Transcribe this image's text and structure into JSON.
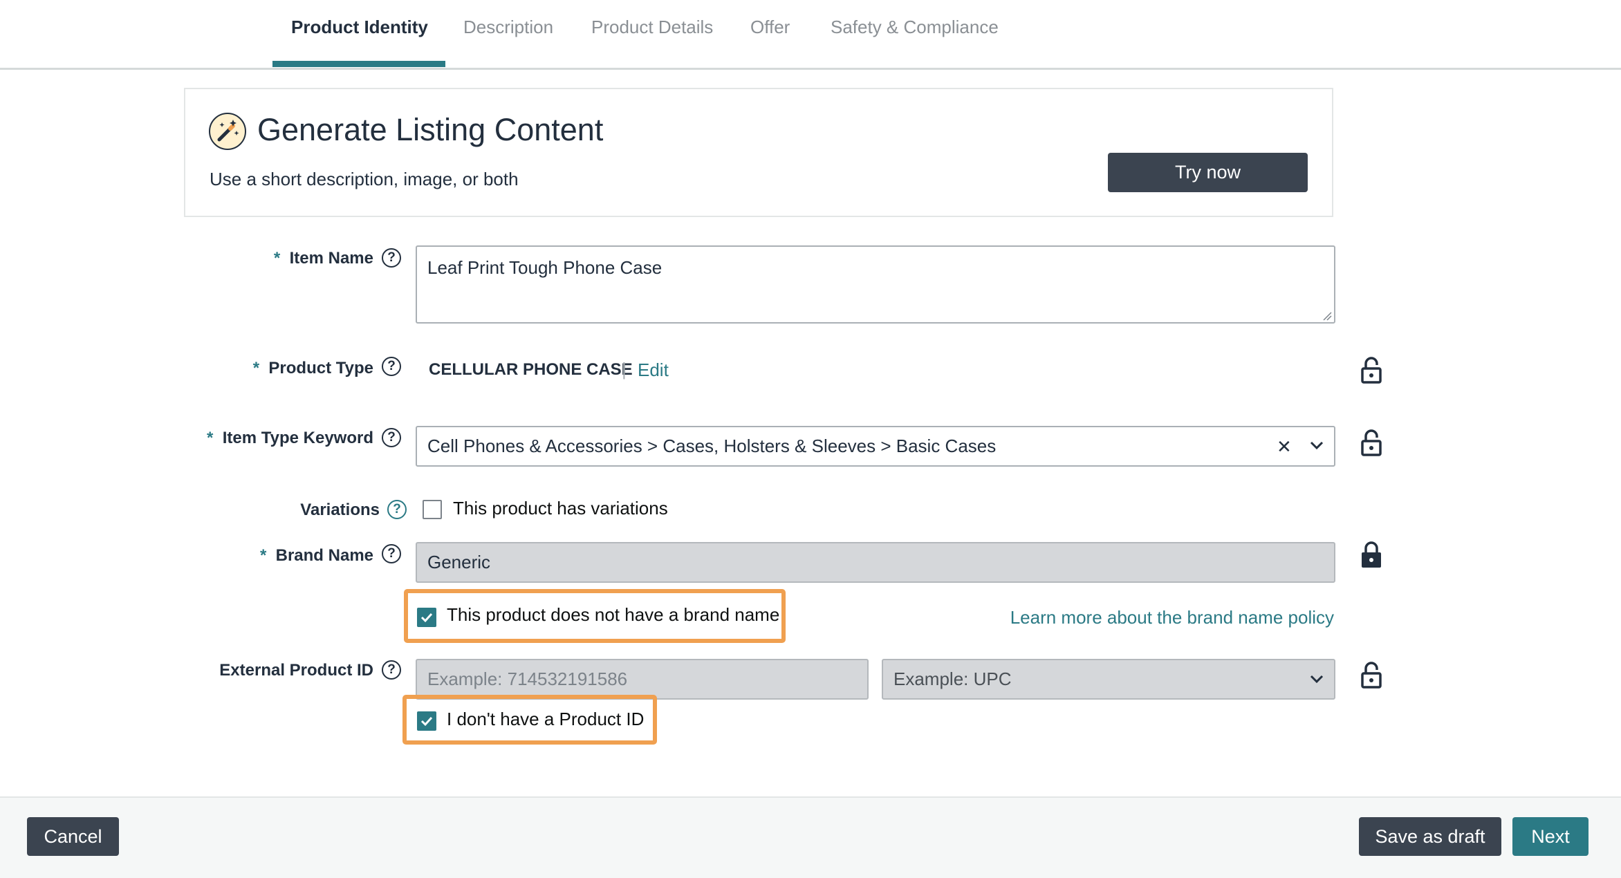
{
  "tabs": [
    {
      "label": "Product Identity",
      "active": true
    },
    {
      "label": "Description",
      "active": false
    },
    {
      "label": "Product Details",
      "active": false
    },
    {
      "label": "Offer",
      "active": false
    },
    {
      "label": "Safety & Compliance",
      "active": false
    }
  ],
  "generate": {
    "title": "Generate Listing Content",
    "subtitle": "Use a short description, image, or both",
    "button": "Try now",
    "icon": "magic-wand-icon"
  },
  "form": {
    "required_mark": "*",
    "help_glyph": "?",
    "item_name": {
      "label": "Item Name",
      "value": "Leaf Print Tough Phone Case"
    },
    "product_type": {
      "label": "Product Type",
      "value": "CELLULAR PHONE CASE",
      "separator": "|",
      "edit_label": "Edit"
    },
    "item_type_keyword": {
      "label": "Item Type Keyword",
      "value": "Cell Phones & Accessories > Cases, Holsters & Sleeves > Basic Cases",
      "clear_glyph": "✕"
    },
    "variations": {
      "label": "Variations",
      "checkbox_label": "This product has variations",
      "checked": false
    },
    "brand_name": {
      "label": "Brand Name",
      "value": "Generic",
      "no_brand_label": "This product does not have a brand name",
      "no_brand_checked": true,
      "policy_link": "Learn more about the brand name policy"
    },
    "external_product_id": {
      "label": "External Product ID",
      "id_placeholder": "Example: 714532191586",
      "type_placeholder": "Example: UPC",
      "no_id_label": "I don't have a Product ID",
      "no_id_checked": true
    }
  },
  "footer": {
    "cancel": "Cancel",
    "save_draft": "Save as draft",
    "next": "Next"
  },
  "colors": {
    "accent": "#2b7a85",
    "dark_button": "#3b4450",
    "highlight": "#f0a050"
  }
}
